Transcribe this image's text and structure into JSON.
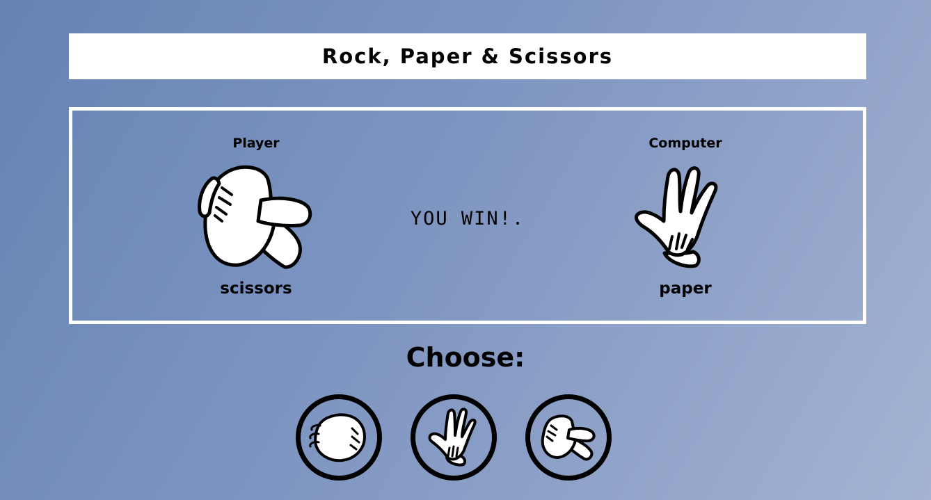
{
  "header": {
    "title": "Rock, Paper & Scissors"
  },
  "arena": {
    "player": {
      "label": "Player",
      "choice": "scissors",
      "icon": "scissors-hand-icon"
    },
    "computer": {
      "label": "Computer",
      "choice": "paper",
      "icon": "paper-hand-icon"
    },
    "result": "YOU WIN!."
  },
  "controls": {
    "heading": "Choose:",
    "options": [
      {
        "value": "rock",
        "icon": "rock-hand-icon"
      },
      {
        "value": "paper",
        "icon": "paper-hand-icon"
      },
      {
        "value": "scissors",
        "icon": "scissors-hand-icon"
      }
    ]
  },
  "colors": {
    "background_start": "#6783b4",
    "background_end": "#a4b3d3",
    "frame": "#ffffff",
    "text": "#000000"
  }
}
